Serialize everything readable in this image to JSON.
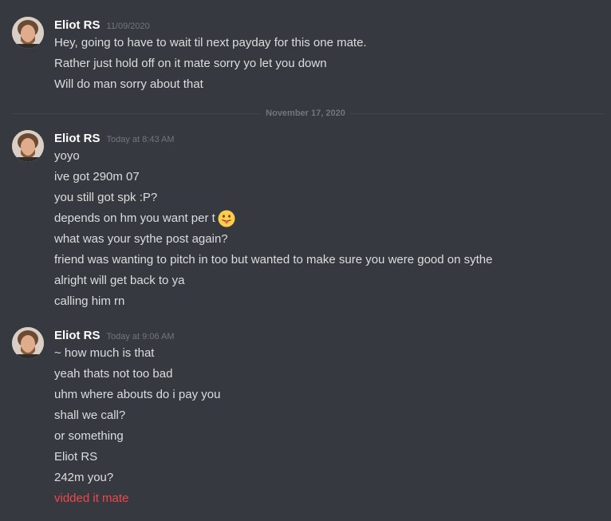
{
  "divider": {
    "label": "November 17, 2020"
  },
  "groups": [
    {
      "username": "Eliot RS",
      "timestamp": "11/09/2020",
      "messages": [
        "Hey, going to have to wait til next payday for this one mate.",
        "Rather just hold off on it mate sorry yo let you down",
        "Will do man sorry about that"
      ]
    },
    {
      "username": "Eliot RS",
      "timestamp": "Today at 8:43 AM",
      "messages": [
        "yoyo",
        "ive got 290m 07",
        "you still got spk :P?",
        "depends on hm you want per t",
        "what was your sythe post again?",
        "friend was wanting to pitch in too but wanted to make sure you were good on sythe",
        "alright will get back to ya",
        "calling him rn"
      ]
    },
    {
      "username": "Eliot RS",
      "timestamp": "Today at 9:06 AM",
      "messages": [
        "~ how much is that",
        "yeah thats not too bad",
        "uhm where abouts do i pay you",
        "shall we call?",
        "or something",
        "Eliot RS",
        "242m you?",
        "vidded it mate"
      ]
    }
  ],
  "icons": {
    "avatar": "user-avatar-photo",
    "emoji": "tongue-out-emoji"
  },
  "colors": {
    "background": "#36393f",
    "username": "#ffffff",
    "text": "#dcddde",
    "highlight_text": "#f04747",
    "timestamp": "#72767d"
  }
}
